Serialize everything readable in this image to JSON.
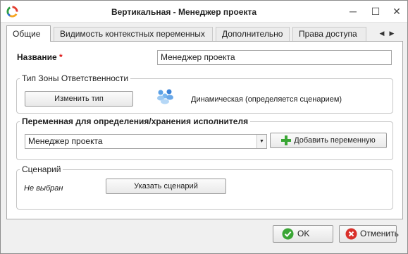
{
  "window": {
    "title": "Вертикальная - Менеджер проекта",
    "minimize_glyph": "─",
    "maximize_glyph": "☐",
    "close_glyph": "✕"
  },
  "tabs": [
    {
      "label": "Общие",
      "active": true
    },
    {
      "label": "Видимость контекстных переменных",
      "active": false
    },
    {
      "label": "Дополнительно",
      "active": false
    },
    {
      "label": "Права доступа",
      "active": false
    }
  ],
  "tab_scroll": {
    "left": "◀",
    "right": "▶"
  },
  "name_field": {
    "label": "Название",
    "required_mark": "*",
    "value": "Менеджер проекта"
  },
  "zone_group": {
    "legend": "Тип Зоны Ответственности",
    "change_button": "Изменить тип",
    "type_icon": "people-cluster-icon",
    "type_text": "Динамическая (определяется сценарием)"
  },
  "variable_group": {
    "legend": "Переменная для определения/хранения исполнителя",
    "selected_value": "Менеджер проекта",
    "add_button": "Добавить переменную"
  },
  "scenario_group": {
    "legend": "Сценарий",
    "status": "Не выбран",
    "set_button": "Указать сценарий"
  },
  "footer": {
    "ok_label": "OK",
    "cancel_label": "Отменить"
  },
  "colors": {
    "accent_green": "#3aa635",
    "cancel_red": "#d9302a",
    "required_red": "#dd1111"
  }
}
